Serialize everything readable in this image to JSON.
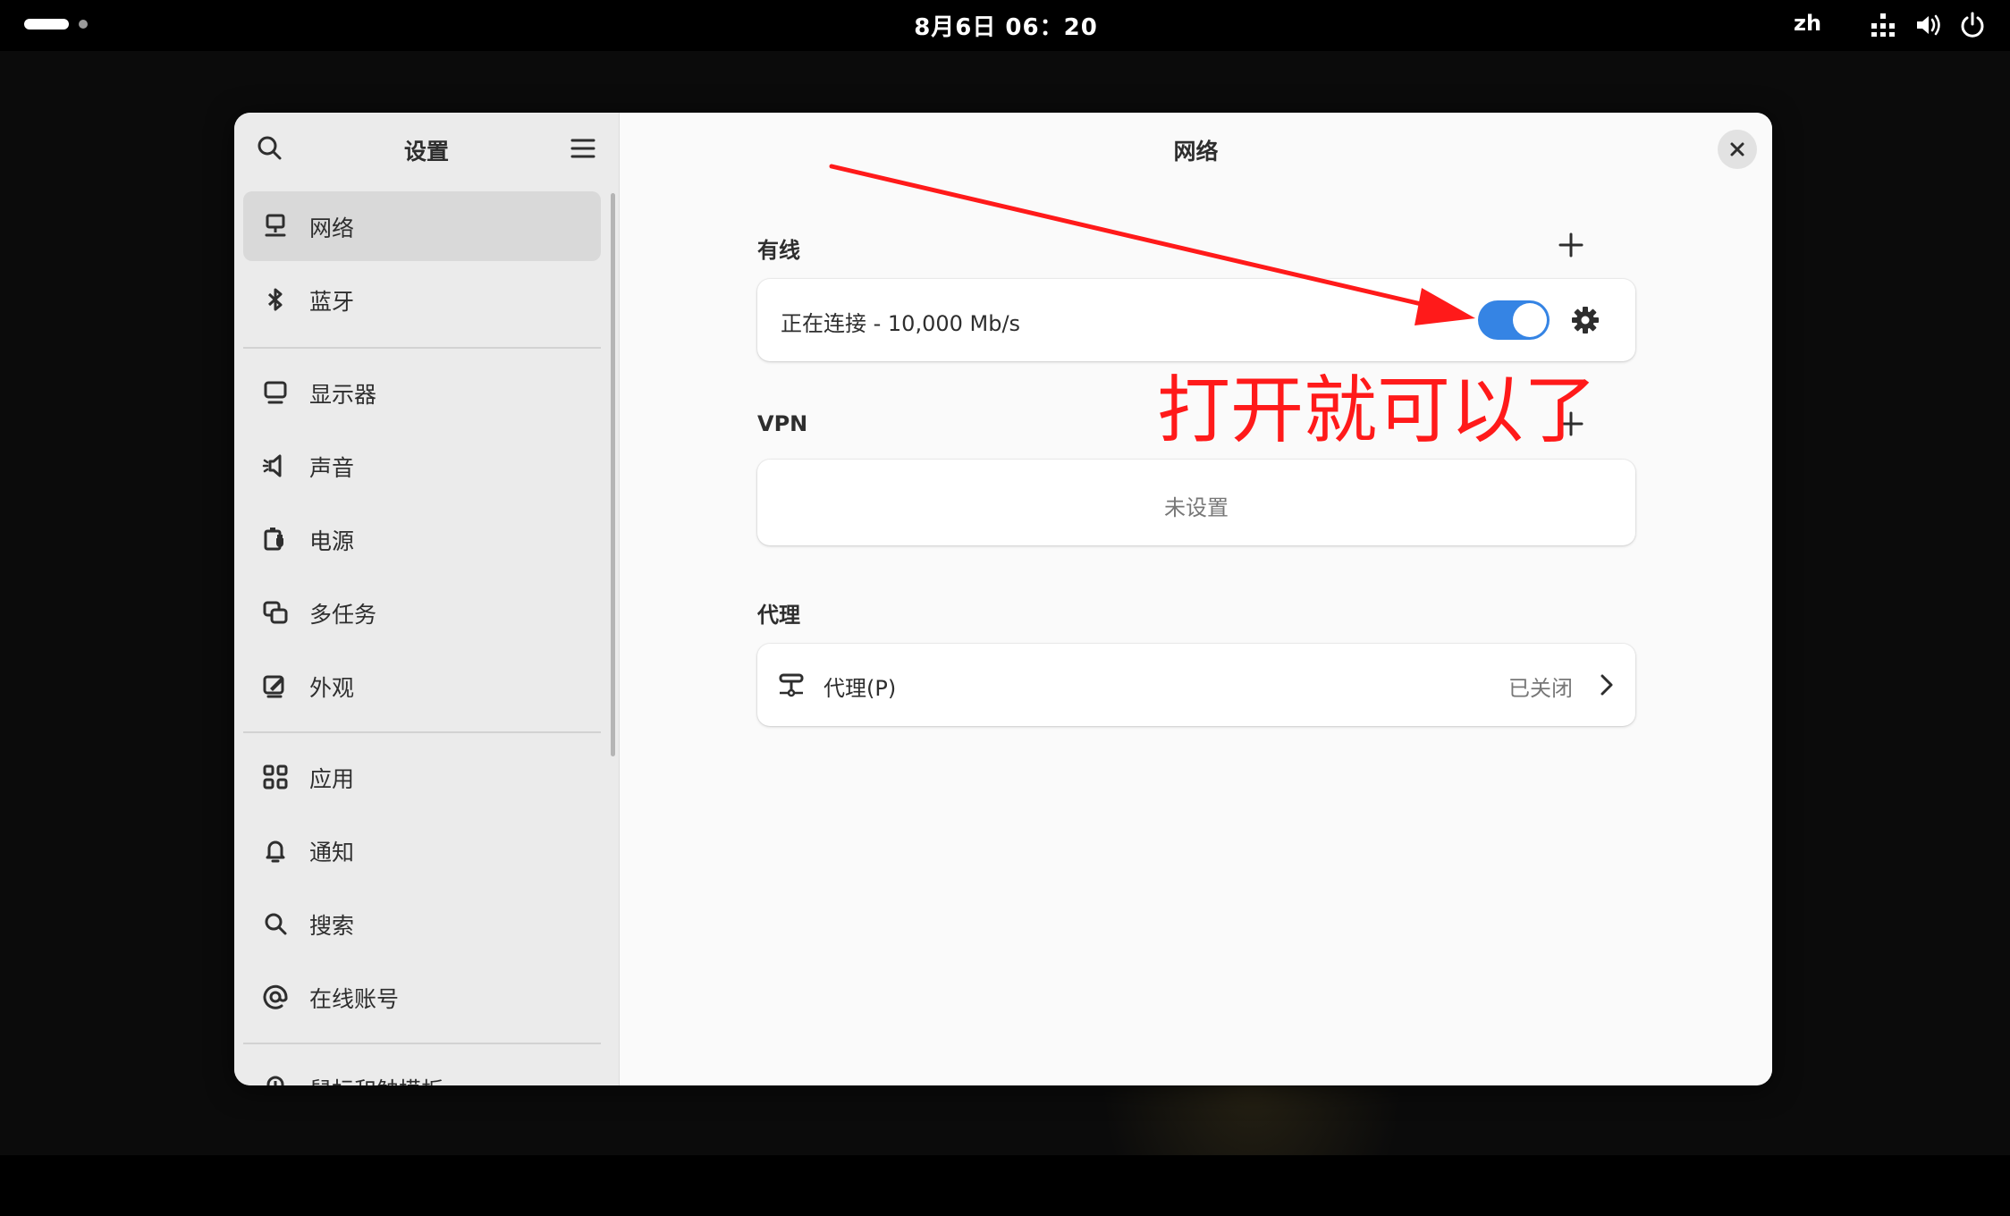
{
  "topbar": {
    "clock": "8月6日  06：20",
    "input_method": "zh",
    "tray_icons": [
      "network-wired-icon",
      "volume-icon",
      "power-icon"
    ]
  },
  "window": {
    "sidebar": {
      "title": "设置",
      "search_icon": "search-icon",
      "menu_icon": "hamburger-menu-icon",
      "items": [
        {
          "label": "网络",
          "icon": "network-wired-icon",
          "selected": true
        },
        {
          "label": "蓝牙",
          "icon": "bluetooth-icon"
        },
        {
          "label": "显示器",
          "icon": "display-icon"
        },
        {
          "label": "声音",
          "icon": "sound-icon"
        },
        {
          "label": "电源",
          "icon": "power-battery-icon"
        },
        {
          "label": "多任务",
          "icon": "multitasking-icon"
        },
        {
          "label": "外观",
          "icon": "appearance-icon"
        },
        {
          "label": "应用",
          "icon": "apps-grid-icon"
        },
        {
          "label": "通知",
          "icon": "bell-icon"
        },
        {
          "label": "搜索",
          "icon": "search-icon"
        },
        {
          "label": "在线账号",
          "icon": "at-sign-icon"
        },
        {
          "label": "鼠标和触摸板",
          "icon": "mouse-icon"
        }
      ]
    },
    "content": {
      "title": "网络",
      "wired": {
        "heading": "有线",
        "status": "正在连接 - 10,000 Mb/s",
        "toggle_on": true
      },
      "vpn": {
        "heading": "VPN",
        "empty": "未设置"
      },
      "proxy": {
        "heading": "代理",
        "label": "代理(P)",
        "status": "已关闭"
      }
    }
  },
  "annotation": {
    "text": "打开就可以了",
    "color": "#ff1a1a"
  },
  "colors": {
    "accent": "#3584e4",
    "annotation": "#ff1a1a"
  }
}
